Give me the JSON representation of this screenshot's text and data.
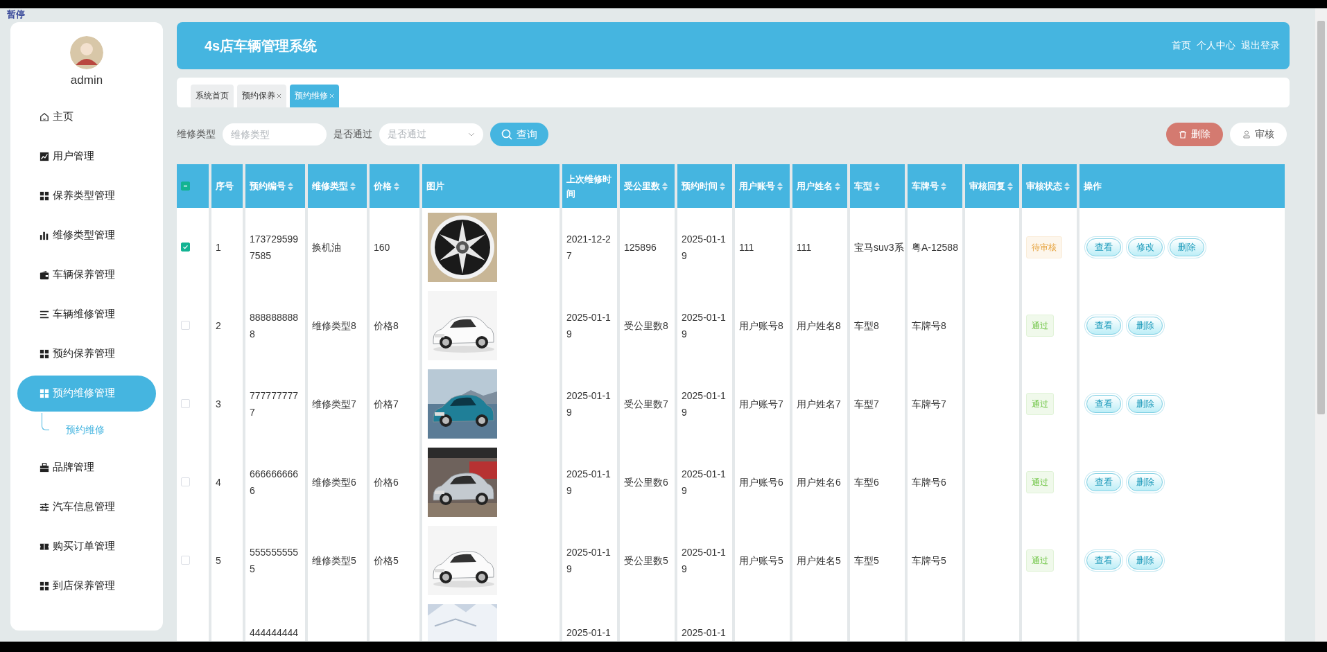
{
  "overlay_label": "暂停",
  "sidebar": {
    "user": "admin",
    "items": [
      {
        "label": "主页",
        "selected": false
      },
      {
        "label": "用户管理",
        "selected": false
      },
      {
        "label": "保养类型管理",
        "selected": false
      },
      {
        "label": "维修类型管理",
        "selected": false
      },
      {
        "label": "车辆保养管理",
        "selected": false
      },
      {
        "label": "车辆维修管理",
        "selected": false
      },
      {
        "label": "预约保养管理",
        "selected": false
      },
      {
        "label": "预约维修管理",
        "selected": true,
        "children": [
          {
            "label": "预约维修",
            "selected": true
          }
        ]
      },
      {
        "label": "品牌管理",
        "selected": false
      },
      {
        "label": "汽车信息管理",
        "selected": false
      },
      {
        "label": "购买订单管理",
        "selected": false
      },
      {
        "label": "到店保养管理",
        "selected": false
      }
    ]
  },
  "header": {
    "title": "4s店车辆管理系统",
    "links": [
      "首页",
      "个人中心",
      "退出登录"
    ]
  },
  "tabs": [
    {
      "label": "系统首页",
      "selected": false,
      "closable": false
    },
    {
      "label": "预约保养",
      "selected": false,
      "closable": true
    },
    {
      "label": "预约维修",
      "selected": true,
      "closable": true
    }
  ],
  "filters": [
    {
      "label": "维修类型",
      "kind": "input",
      "placeholder": "维修类型"
    },
    {
      "label": "是否通过",
      "kind": "select",
      "placeholder": "是否通过"
    }
  ],
  "search_button": "查询",
  "toolbar": [
    {
      "label": "删除",
      "kind": "danger"
    },
    {
      "label": "审核",
      "kind": "plain"
    }
  ],
  "table": {
    "select_all": {
      "indeterminate": true
    },
    "columns": [
      {
        "label": "序号",
        "sortable": false
      },
      {
        "label": "预约编号",
        "sortable": true
      },
      {
        "label": "维修类型",
        "sortable": true
      },
      {
        "label": "价格",
        "sortable": true
      },
      {
        "label": "图片",
        "sortable": false
      },
      {
        "label": "上次维修时间",
        "sortable": false
      },
      {
        "label": "受公里数",
        "sortable": true
      },
      {
        "label": "预约时间",
        "sortable": true
      },
      {
        "label": "用户账号",
        "sortable": true
      },
      {
        "label": "用户姓名",
        "sortable": true
      },
      {
        "label": "车型",
        "sortable": true
      },
      {
        "label": "车牌号",
        "sortable": true
      },
      {
        "label": "审核回复",
        "sortable": true
      },
      {
        "label": "审核状态",
        "sortable": true
      },
      {
        "label": "操作",
        "sortable": false
      }
    ],
    "rows": [
      {
        "checked": true,
        "index": "1",
        "number": "1737295997585",
        "repair_type": "换机油",
        "price": "160",
        "last_repair": "2021-12-27",
        "mileage": "125896",
        "appoint_time": "2025-01-19",
        "account": "111",
        "name": "111",
        "model": "宝马suv3系",
        "plate": "粤A-12588",
        "status": {
          "label": "待审核",
          "kind": "pending"
        },
        "actions": [
          "查看",
          "修改",
          "删除"
        ]
      },
      {
        "checked": false,
        "index": "2",
        "number": "8888888888",
        "repair_type": "维修类型8",
        "price": "价格8",
        "last_repair": "2025-01-19",
        "mileage": "受公里数8",
        "appoint_time": "2025-01-19",
        "account": "用户账号8",
        "name": "用户姓名8",
        "model": "车型8",
        "plate": "车牌号8",
        "status": {
          "label": "通过",
          "kind": "passed"
        },
        "actions": [
          "查看",
          "删除"
        ]
      },
      {
        "checked": false,
        "index": "3",
        "number": "7777777777",
        "repair_type": "维修类型7",
        "price": "价格7",
        "last_repair": "2025-01-19",
        "mileage": "受公里数7",
        "appoint_time": "2025-01-19",
        "account": "用户账号7",
        "name": "用户姓名7",
        "model": "车型7",
        "plate": "车牌号7",
        "status": {
          "label": "通过",
          "kind": "passed"
        },
        "actions": [
          "查看",
          "删除"
        ]
      },
      {
        "checked": false,
        "index": "4",
        "number": "6666666666",
        "repair_type": "维修类型6",
        "price": "价格6",
        "last_repair": "2025-01-19",
        "mileage": "受公里数6",
        "appoint_time": "2025-01-19",
        "account": "用户账号6",
        "name": "用户姓名6",
        "model": "车型6",
        "plate": "车牌号6",
        "status": {
          "label": "通过",
          "kind": "passed"
        },
        "actions": [
          "查看",
          "删除"
        ]
      },
      {
        "checked": false,
        "index": "5",
        "number": "5555555555",
        "repair_type": "维修类型5",
        "price": "价格5",
        "last_repair": "2025-01-19",
        "mileage": "受公里数5",
        "appoint_time": "2025-01-19",
        "account": "用户账号5",
        "name": "用户姓名5",
        "model": "车型5",
        "plate": "车牌号5",
        "status": {
          "label": "通过",
          "kind": "passed"
        },
        "actions": [
          "查看",
          "删除"
        ]
      },
      {
        "number": "444444444",
        "last_repair": "2025-01-1",
        "appoint_time": "2025-01-1"
      }
    ]
  }
}
